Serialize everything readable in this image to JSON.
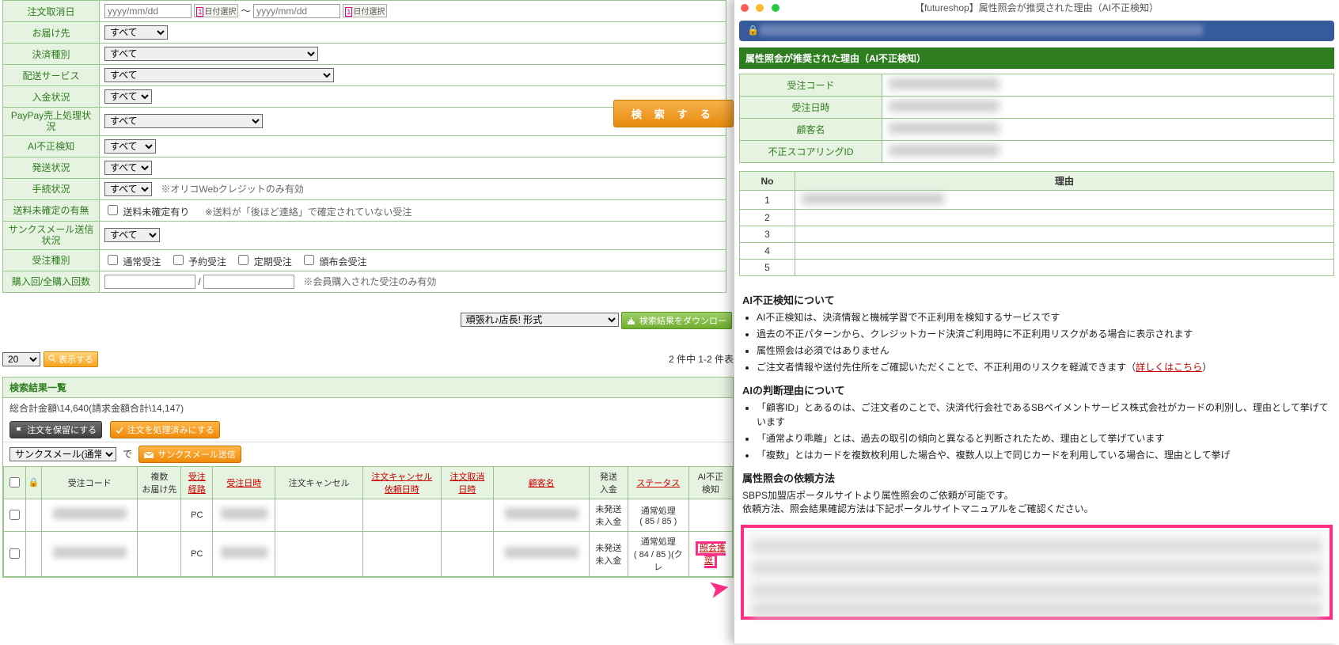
{
  "form": {
    "cancel_date": {
      "label": "注文取消日",
      "ph1": "yyyy/mm/dd",
      "ph2": "yyyy/mm/dd",
      "btn": "日付選択",
      "sep": "～"
    },
    "deliver_to": {
      "label": "お届け先",
      "value": "すべて"
    },
    "payment_type": {
      "label": "決済種別",
      "value": "すべて"
    },
    "ship_service": {
      "label": "配送サービス",
      "value": "すべて"
    },
    "payment_status": {
      "label": "入金状況",
      "value": "すべて"
    },
    "paypay": {
      "label": "PayPay売上処理状況",
      "value": "すべて"
    },
    "ai_fraud": {
      "label": "AI不正検知",
      "value": "すべて"
    },
    "ship_status": {
      "label": "発送状況",
      "value": "すべて"
    },
    "procedure": {
      "label": "手続状況",
      "value": "すべて",
      "note": "※オリコWebクレジットのみ有効"
    },
    "shipfee": {
      "label": "送料未確定の有無",
      "cb": "送料未確定有り",
      "note": "※送料が「後ほど連絡」で確定されていない受注"
    },
    "thanks": {
      "label": "サンクスメール送信状況",
      "value": "すべて"
    },
    "order_type": {
      "label": "受注種別",
      "o1": "通常受注",
      "o2": "予約受注",
      "o3": "定期受注",
      "o4": "頒布会受注"
    },
    "purchase_count": {
      "label": "購入回/全購入回数",
      "sep": "/",
      "note": "※会員購入された受注のみ有効"
    }
  },
  "search_btn": "検 索 す る",
  "download": {
    "format": "頑張れ♪店長! 形式",
    "btn": "検索結果をダウンロー"
  },
  "perpage": {
    "value": "20",
    "show": "表示する",
    "count": "2 件中 1-2 件表"
  },
  "results": {
    "title": "検索結果一覧",
    "summary": "総合計金額\\14,640(請求金額合計\\14,147)",
    "hold_btn": "注文を保留にする",
    "done_btn": "注文を処理済みにする",
    "tmail_select": "サンクスメール(通常)",
    "de": "で",
    "tmail_btn": "サンクスメール送信"
  },
  "cols": {
    "c1": "受注コード",
    "c2a": "複数",
    "c2b": "お届け先",
    "c3a": "受注",
    "c3b": "経路",
    "c4": "受注日時",
    "c5": "注文キャンセル",
    "c6a": "注文キャンセル",
    "c6b": "依頼日時",
    "c7a": "注文取消",
    "c7b": "日時",
    "c8": "顧客名",
    "c9a": "発送",
    "c9b": "入金",
    "c10": "ステータス",
    "c11a": "AI不正",
    "c11b": "検知"
  },
  "rows": [
    {
      "route": "PC",
      "ship": "未発送",
      "pay": "未入金",
      "status": "通常処理",
      "status2": "( 85 / 85 )",
      "ai": ""
    },
    {
      "route": "PC",
      "ship": "未発送",
      "pay": "未入金",
      "status": "通常処理",
      "status2": "( 84 / 85 )",
      "status_extra": "(クレ",
      "ai": "照会推奨"
    }
  ],
  "popup": {
    "title": "【futureshop】属性照会が推奨された理由（AI不正検知）",
    "green": "属性照会が推奨された理由（AI不正検知）",
    "info": {
      "code": "受注コード",
      "date": "受注日時",
      "customer": "顧客名",
      "scoring": "不正スコアリングID"
    },
    "reason_head": {
      "no": "No",
      "reason": "理由"
    },
    "reason_rows": [
      "1",
      "2",
      "3",
      "4",
      "5"
    ],
    "section1_title": "AI不正検知について",
    "s1": [
      "AI不正検知は、決済情報と機械学習で不正利用を検知するサービスです",
      "過去の不正パターンから、クレジットカード決済ご利用時に不正利用リスクがある場合に表示されます",
      "属性照会は必須ではありません",
      "ご注文者情報や送付先住所をご確認いただくことで、不正利用のリスクを軽減できます（"
    ],
    "s1_link": "詳しくはこちら",
    "s1_close": "）",
    "section2_title": "AIの判断理由について",
    "s2": [
      "「顧客ID」とあるのは、ご注文者のことで、決済代行会社であるSBペイメントサービス株式会社がカードの利別し、理由として挙げています",
      "「通常より乖離」とは、過去の取引の傾向と異なると判断されたため、理由として挙げています",
      "「複数」とはカードを複数枚利用した場合や、複数人以上で同じカードを利用している場合に、理由として挙げ"
    ],
    "section3_title": "属性照会の依頼方法",
    "s3a": "SBPS加盟店ポータルサイトより属性照会のご依頼が可能です。",
    "s3b": "依頼方法、照会結果確認方法は下記ポータルサイトマニュアルをご確認ください。"
  }
}
